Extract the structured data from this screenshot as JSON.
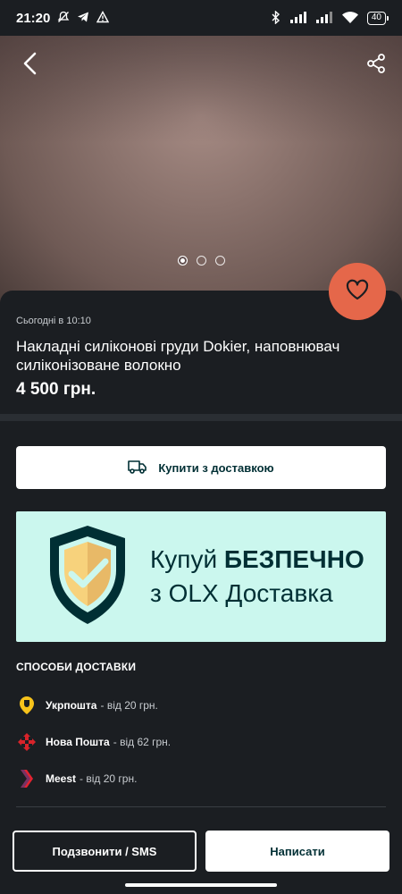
{
  "status_bar": {
    "time": "21:20",
    "battery": "40",
    "icons": [
      "bell-off-icon",
      "telegram-icon",
      "warning-icon",
      "bluetooth-icon",
      "signal-icon",
      "signal-icon",
      "wifi-icon",
      "battery-icon"
    ]
  },
  "gallery": {
    "image_count": 3,
    "active_index": 0
  },
  "listing": {
    "posted": "Сьогодні в 10:10",
    "title": "Накладні силіконові груди Dokier, наповнювач силіконізоване волокно",
    "price": "4 500 грн."
  },
  "buy_button": {
    "label": "Купити з доставкою"
  },
  "banner": {
    "text_normal_1": "Купуй ",
    "text_bold": "БЕЗПЕЧНО",
    "text_line2": "з OLX Доставка"
  },
  "delivery": {
    "heading": "СПОСОБИ ДОСТАВКИ",
    "items": [
      {
        "name": "Укрпошта",
        "price": "- від 20 грн.",
        "icon": "ukrposhta-icon",
        "color": "#f7c31b"
      },
      {
        "name": "Нова Пошта",
        "price": "- від 62 грн.",
        "icon": "nova-poshta-icon",
        "color": "#d8232a"
      },
      {
        "name": "Meest",
        "price": "- від 20 грн.",
        "icon": "meest-icon",
        "color": "#e4222f"
      }
    ]
  },
  "actions": {
    "call_label": "Подзвонити / SMS",
    "write_label": "Написати"
  },
  "colors": {
    "background": "#1b1e22",
    "favorite": "#e5674a",
    "banner": "#cbf7ee",
    "brand_dark": "#002f34"
  }
}
